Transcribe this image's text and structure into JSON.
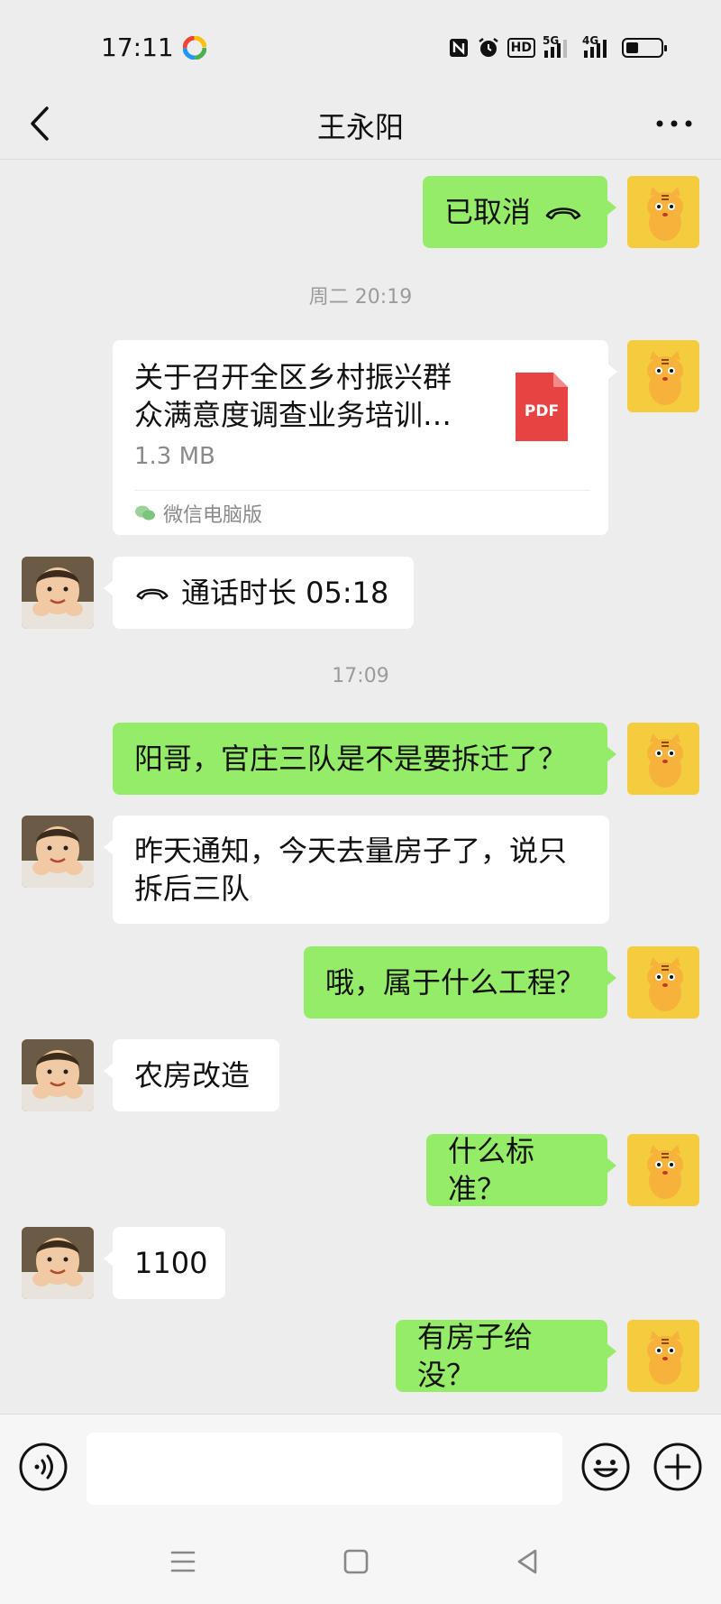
{
  "status_bar": {
    "time": "17:11",
    "hd_label": "HD",
    "net1_label": "5G",
    "net2_label": "4G"
  },
  "header": {
    "title": "王永阳"
  },
  "messages": {
    "m1": {
      "text": "已取消",
      "sender": "me"
    },
    "ts1": "周二 20:19",
    "file": {
      "name": "关于召开全区乡村振兴群众满意度调查业务培训…",
      "size": "1.3 MB",
      "icon_label": "PDF",
      "source": "微信电脑版",
      "sender": "me"
    },
    "m2": {
      "text": "通话时长 05:18",
      "sender": "friend"
    },
    "ts2": "17:09",
    "m3": {
      "text": "阳哥，官庄三队是不是要拆迁了？",
      "sender": "me"
    },
    "m4": {
      "text": "昨天通知，今天去量房子了，说只拆后三队",
      "sender": "friend"
    },
    "m5": {
      "text": "哦，属于什么工程？",
      "sender": "me"
    },
    "m6": {
      "text": "农房改造",
      "sender": "friend"
    },
    "m7": {
      "text": "什么标准？",
      "sender": "me"
    },
    "m8": {
      "text": "1100",
      "sender": "friend"
    },
    "m9": {
      "text": "有房子给没？",
      "sender": "me"
    }
  },
  "input_bar": {
    "placeholder": ""
  },
  "colors": {
    "my_bubble": "#95ec69",
    "friend_bubble": "#ffffff",
    "background": "#ededed",
    "pdf_red": "#e84343"
  }
}
